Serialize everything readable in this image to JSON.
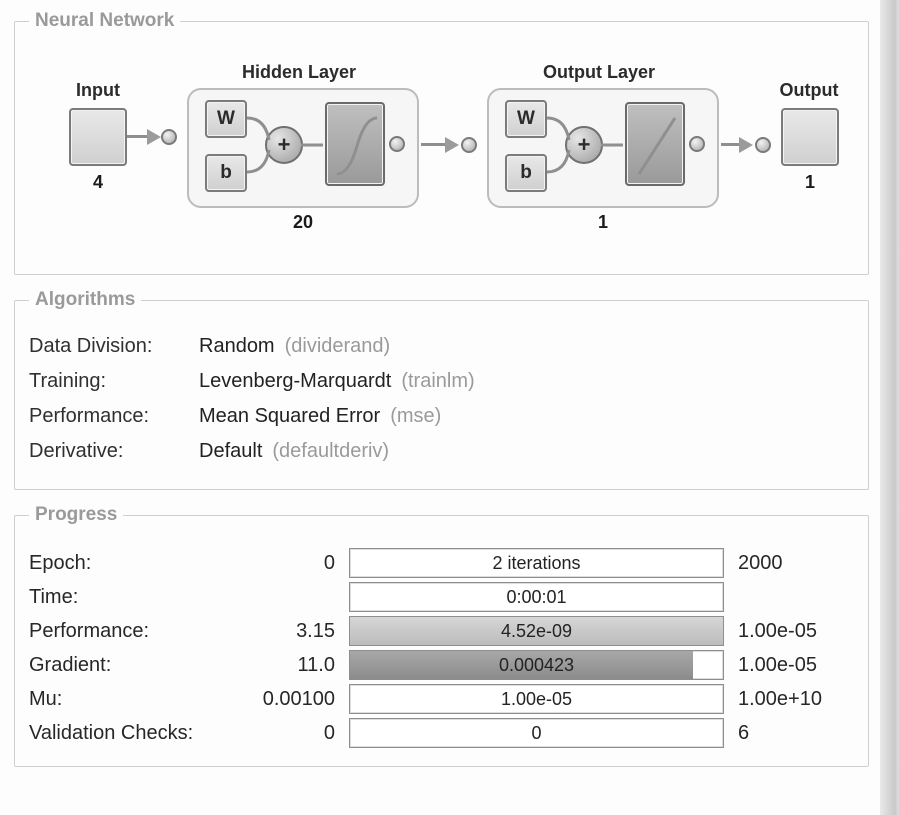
{
  "panels": {
    "neural": {
      "title": "Neural Network"
    },
    "algorithms": {
      "title": "Algorithms"
    },
    "progress": {
      "title": "Progress"
    }
  },
  "network": {
    "input": {
      "label": "Input",
      "size": "4"
    },
    "hidden": {
      "label": "Hidden Layer",
      "size": "20",
      "w": "W",
      "b": "b",
      "sum": "+"
    },
    "output_layer": {
      "label": "Output Layer",
      "size": "1",
      "w": "W",
      "b": "b",
      "sum": "+"
    },
    "output": {
      "label": "Output",
      "size": "1"
    }
  },
  "algorithms": {
    "data_division": {
      "label": "Data Division:",
      "value": "Random",
      "fn": "(dividerand)"
    },
    "training": {
      "label": "Training:",
      "value": "Levenberg-Marquardt",
      "fn": "(trainlm)"
    },
    "performance": {
      "label": "Performance:",
      "value": "Mean Squared Error",
      "fn": "(mse)"
    },
    "derivative": {
      "label": "Derivative:",
      "value": "Default",
      "fn": "(defaultderiv)"
    }
  },
  "progress": {
    "epoch": {
      "label": "Epoch:",
      "left": "0",
      "center": "2 iterations",
      "right": "2000",
      "fill": 0
    },
    "time": {
      "label": "Time:",
      "left": "",
      "center": "0:00:01",
      "right": "",
      "fill": 0
    },
    "performance": {
      "label": "Performance:",
      "left": "3.15",
      "center": "4.52e-09",
      "right": "1.00e-05",
      "fill": 100
    },
    "gradient": {
      "label": "Gradient:",
      "left": "11.0",
      "center": "0.000423",
      "right": "1.00e-05",
      "fill": 92
    },
    "mu": {
      "label": "Mu:",
      "left": "0.00100",
      "center": "1.00e-05",
      "right": "1.00e+10",
      "fill": 0
    },
    "validation": {
      "label": "Validation Checks:",
      "left": "0",
      "center": "0",
      "right": "6",
      "fill": 0
    }
  }
}
